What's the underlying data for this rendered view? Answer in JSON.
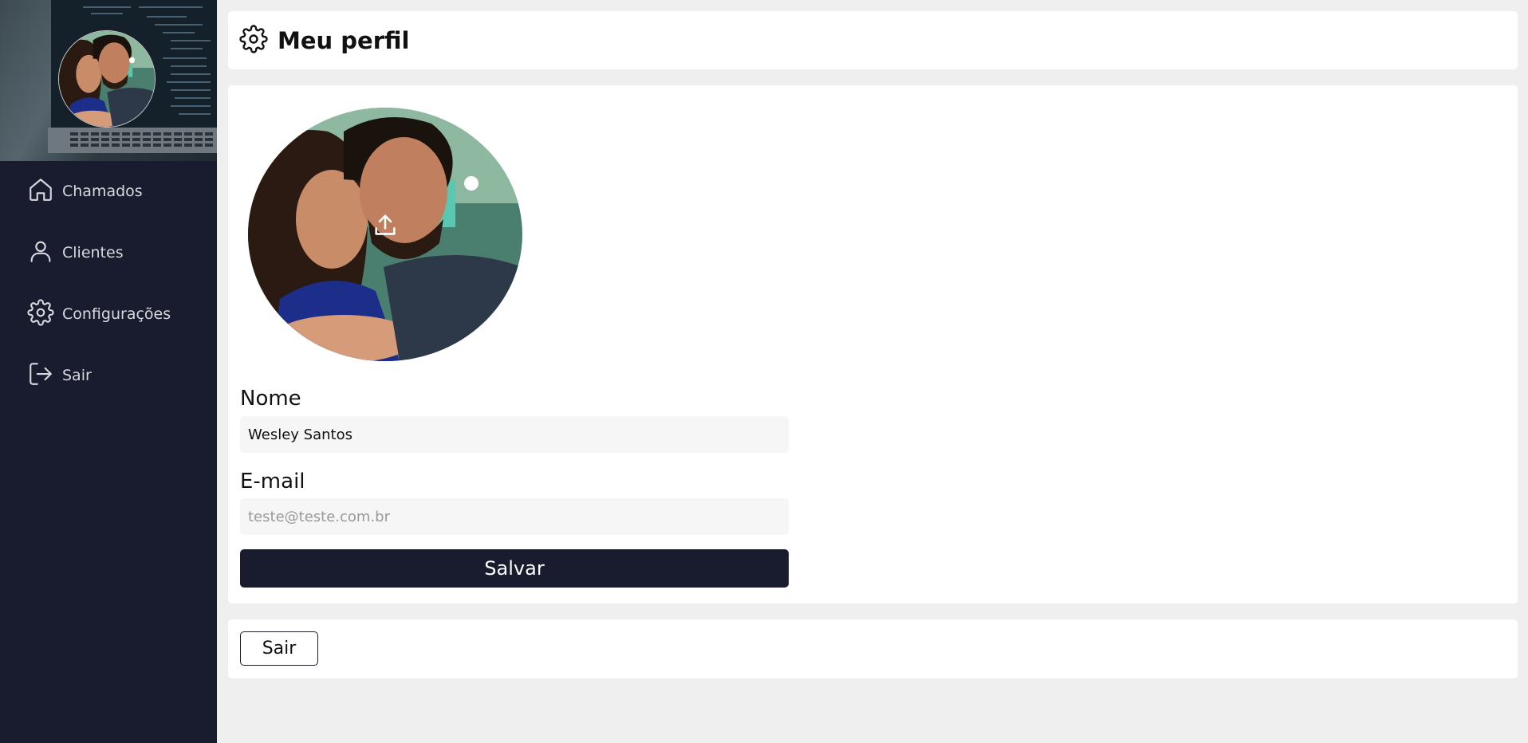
{
  "sidebar": {
    "items": [
      {
        "label": "Chamados",
        "icon": "home-icon"
      },
      {
        "label": "Clientes",
        "icon": "user-icon"
      },
      {
        "label": "Configurações",
        "icon": "gear-icon"
      },
      {
        "label": "Sair",
        "icon": "logout-icon"
      }
    ]
  },
  "header": {
    "title": "Meu perfil",
    "icon": "gear-icon"
  },
  "profile": {
    "name_label": "Nome",
    "name_value": "Wesley Santos",
    "email_label": "E-mail",
    "email_placeholder": "teste@teste.com.br",
    "save_label": "Salvar"
  },
  "logout": {
    "label": "Sair"
  },
  "colors": {
    "sidebar_bg": "#181c2e",
    "page_bg": "#efefef",
    "card_bg": "#ffffff",
    "button_bg": "#181c2e"
  }
}
